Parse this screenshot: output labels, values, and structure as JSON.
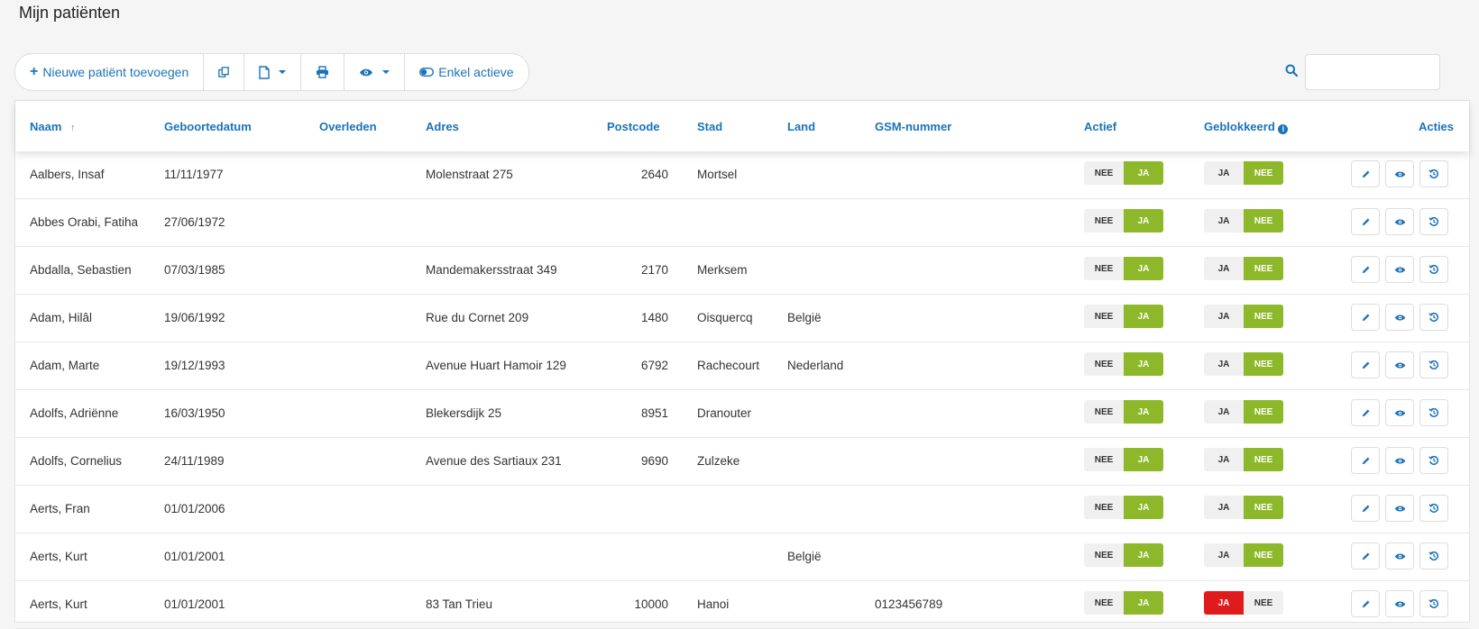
{
  "page": {
    "title": "Mijn patiënten"
  },
  "toolbar": {
    "add_label": "Nieuwe patiënt toevoegen",
    "active_only_label": "Enkel actieve"
  },
  "search": {
    "placeholder": ""
  },
  "columns": {
    "naam": "Naam",
    "geboortedatum": "Geboortedatum",
    "overleden": "Overleden",
    "adres": "Adres",
    "postcode": "Postcode",
    "stad": "Stad",
    "land": "Land",
    "gsm": "GSM-nummer",
    "actief": "Actief",
    "geblokkeerd": "Geblokkeerd",
    "acties": "Acties"
  },
  "toggle_labels": {
    "nee": "NEE",
    "ja": "JA"
  },
  "colors": {
    "accent": "#1a73b8",
    "green": "#8db82a",
    "red": "#e01b1b"
  },
  "rows": [
    {
      "naam": "Aalbers, Insaf",
      "geboortedatum": "11/11/1977",
      "overleden": "",
      "adres": "Molenstraat 275",
      "postcode": "2640",
      "stad": "Mortsel",
      "land": "",
      "gsm": "",
      "actief": true,
      "geblokkeerd": false
    },
    {
      "naam": "Abbes Orabi, Fatiha",
      "geboortedatum": "27/06/1972",
      "overleden": "",
      "adres": "",
      "postcode": "",
      "stad": "",
      "land": "",
      "gsm": "",
      "actief": true,
      "geblokkeerd": false
    },
    {
      "naam": "Abdalla, Sebastien",
      "geboortedatum": "07/03/1985",
      "overleden": "",
      "adres": "Mandemakersstraat 349",
      "postcode": "2170",
      "stad": "Merksem",
      "land": "",
      "gsm": "",
      "actief": true,
      "geblokkeerd": false
    },
    {
      "naam": "Adam, Hilâl",
      "geboortedatum": "19/06/1992",
      "overleden": "",
      "adres": "Rue du Cornet 209",
      "postcode": "1480",
      "stad": "Oisquercq",
      "land": "België",
      "gsm": "",
      "actief": true,
      "geblokkeerd": false
    },
    {
      "naam": "Adam, Marte",
      "geboortedatum": "19/12/1993",
      "overleden": "",
      "adres": "Avenue Huart Hamoir 129",
      "postcode": "6792",
      "stad": "Rachecourt",
      "land": "Nederland",
      "gsm": "",
      "actief": true,
      "geblokkeerd": false
    },
    {
      "naam": "Adolfs, Adriënne",
      "geboortedatum": "16/03/1950",
      "overleden": "",
      "adres": "Blekersdijk 25",
      "postcode": "8951",
      "stad": "Dranouter",
      "land": "",
      "gsm": "",
      "actief": true,
      "geblokkeerd": false
    },
    {
      "naam": "Adolfs, Cornelius",
      "geboortedatum": "24/11/1989",
      "overleden": "",
      "adres": "Avenue des Sartiaux 231",
      "postcode": "9690",
      "stad": "Zulzeke",
      "land": "",
      "gsm": "",
      "actief": true,
      "geblokkeerd": false
    },
    {
      "naam": "Aerts, Fran",
      "geboortedatum": "01/01/2006",
      "overleden": "",
      "adres": "",
      "postcode": "",
      "stad": "",
      "land": "",
      "gsm": "",
      "actief": true,
      "geblokkeerd": false
    },
    {
      "naam": "Aerts, Kurt",
      "geboortedatum": "01/01/2001",
      "overleden": "",
      "adres": "",
      "postcode": "",
      "stad": "",
      "land": "België",
      "gsm": "",
      "actief": true,
      "geblokkeerd": false
    },
    {
      "naam": "Aerts, Kurt",
      "geboortedatum": "01/01/2001",
      "overleden": "",
      "adres": "83 Tan Trieu",
      "postcode": "10000",
      "stad": "Hanoi",
      "land": "",
      "gsm": "0123456789",
      "actief": true,
      "geblokkeerd": true
    }
  ]
}
